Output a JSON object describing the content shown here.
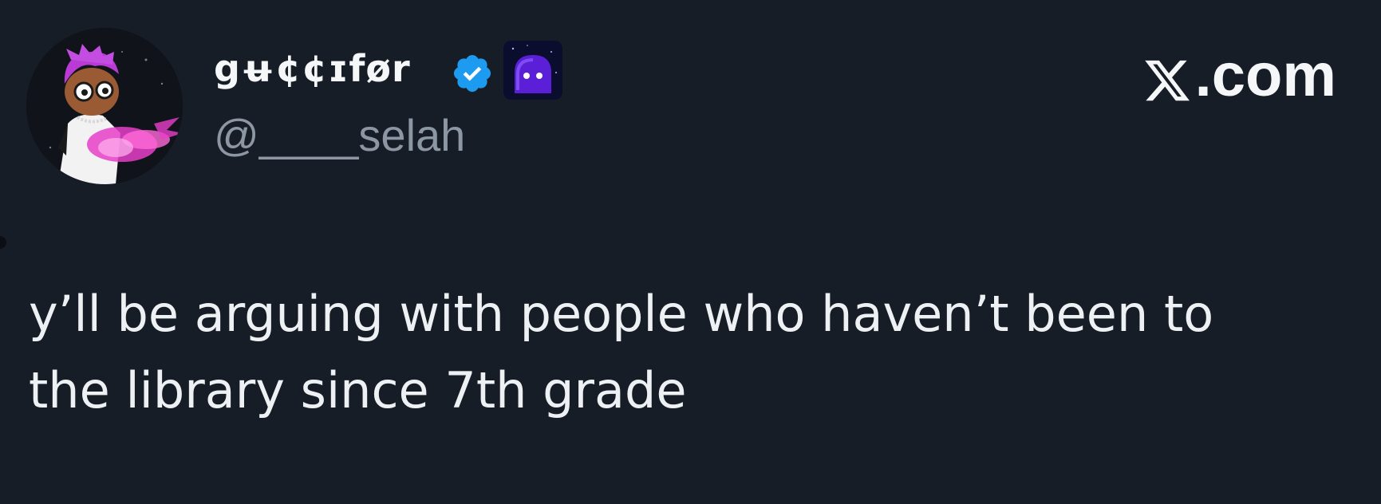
{
  "tweet": {
    "author": {
      "display_name": "gʉ¢¢ɪfør",
      "handle": "@____selah",
      "avatar_icon": "cartoon-character-avatar",
      "verified_icon": "verified-badge-icon",
      "emoji_badge_icon": "purple-ghost-emoji"
    },
    "brand": {
      "label": ".com",
      "icon": "x-logo-icon"
    },
    "text_lines": [
      "y’ll be arguing with people who haven’t been to",
      "the library since 7th grade"
    ]
  },
  "colors": {
    "background": "#171d27",
    "text": "#eef1f4",
    "handle_text": "#8c97a3",
    "verified_blue": "#1d9bf0",
    "emoji_purple": "#5a1fd6",
    "avatar_pink": "#e83fc9"
  }
}
